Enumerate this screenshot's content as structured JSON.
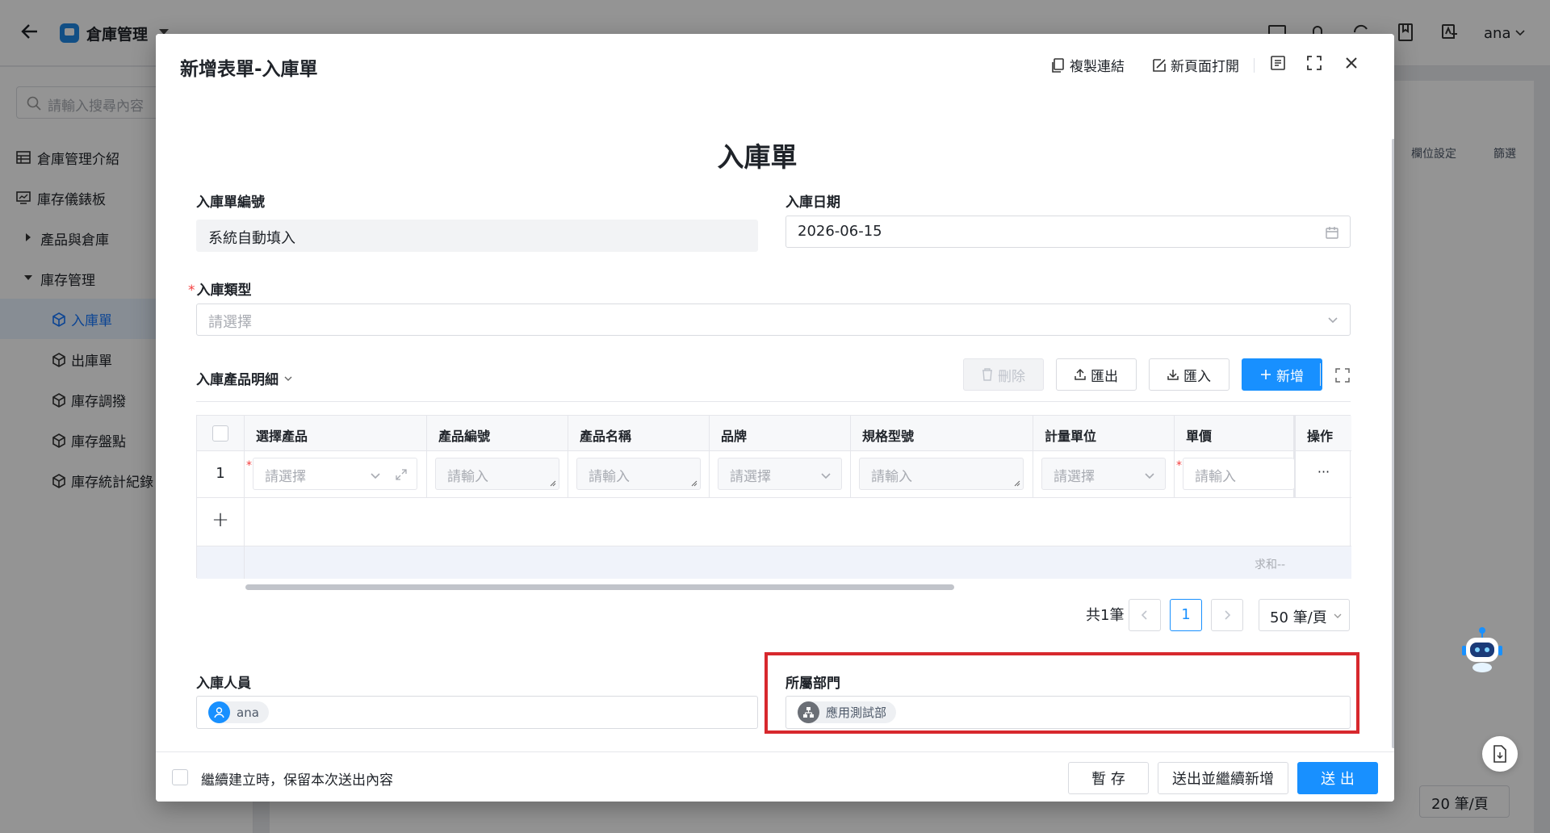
{
  "app": {
    "title": "倉庫管理",
    "user": "ana",
    "search_placeholder": "請輸入搜尋內容"
  },
  "sidebar": {
    "items": [
      {
        "label": "倉庫管理介紹",
        "icon": "table-icon"
      },
      {
        "label": "庫存儀錶板",
        "icon": "dashboard-icon"
      },
      {
        "label": "產品與倉庫",
        "icon": "caret-right-icon"
      },
      {
        "label": "庫存管理",
        "icon": "caret-down-icon"
      },
      {
        "label": "入庫單",
        "icon": "cube-icon",
        "active": true
      },
      {
        "label": "出庫單",
        "icon": "cube-icon"
      },
      {
        "label": "庫存調撥",
        "icon": "cube-icon"
      },
      {
        "label": "庫存盤點",
        "icon": "cube-icon"
      },
      {
        "label": "庫存統計紀錄",
        "icon": "cube-icon"
      }
    ]
  },
  "background": {
    "column_settings": "欄位設定",
    "filter": "篩選",
    "page_size": "20 筆/頁"
  },
  "modal": {
    "title": "新增表單-入庫單",
    "copy_link": "複製連結",
    "open_new_page": "新頁面打開",
    "form_title": "入庫單",
    "fields": {
      "receipt_no": {
        "label": "入庫單編號",
        "value": "系統自動填入"
      },
      "receipt_date": {
        "label": "入庫日期",
        "value": "2026-06-15"
      },
      "receipt_type": {
        "label": "入庫類型",
        "placeholder": "請選擇",
        "required": true
      },
      "receiver": {
        "label": "入庫人員",
        "value": "ana"
      },
      "department": {
        "label": "所屬部門",
        "value": "應用測試部"
      }
    },
    "details": {
      "title": "入庫產品明細",
      "buttons": {
        "delete": "刪除",
        "export": "匯出",
        "import": "匯入",
        "add": "新增"
      },
      "columns": [
        "選擇產品",
        "產品編號",
        "產品名稱",
        "品牌",
        "規格型號",
        "計量單位",
        "單價",
        "操作"
      ],
      "row": {
        "index": "1",
        "select_placeholder": "請選擇",
        "input_placeholder": "請輸入",
        "more": "···"
      },
      "add_row": "+",
      "sum_label": "求和--",
      "pager": {
        "total": "共1筆",
        "page": "1",
        "page_size": "50 筆/頁"
      }
    },
    "footer": {
      "keep_content": "繼續建立時，保留本次送出內容",
      "save_draft": "暫 存",
      "submit_continue": "送出並繼續新增",
      "submit": "送 出"
    }
  },
  "colors": {
    "primary": "#1890ff",
    "highlight": "#d7282d",
    "required": "#f53f3f"
  }
}
